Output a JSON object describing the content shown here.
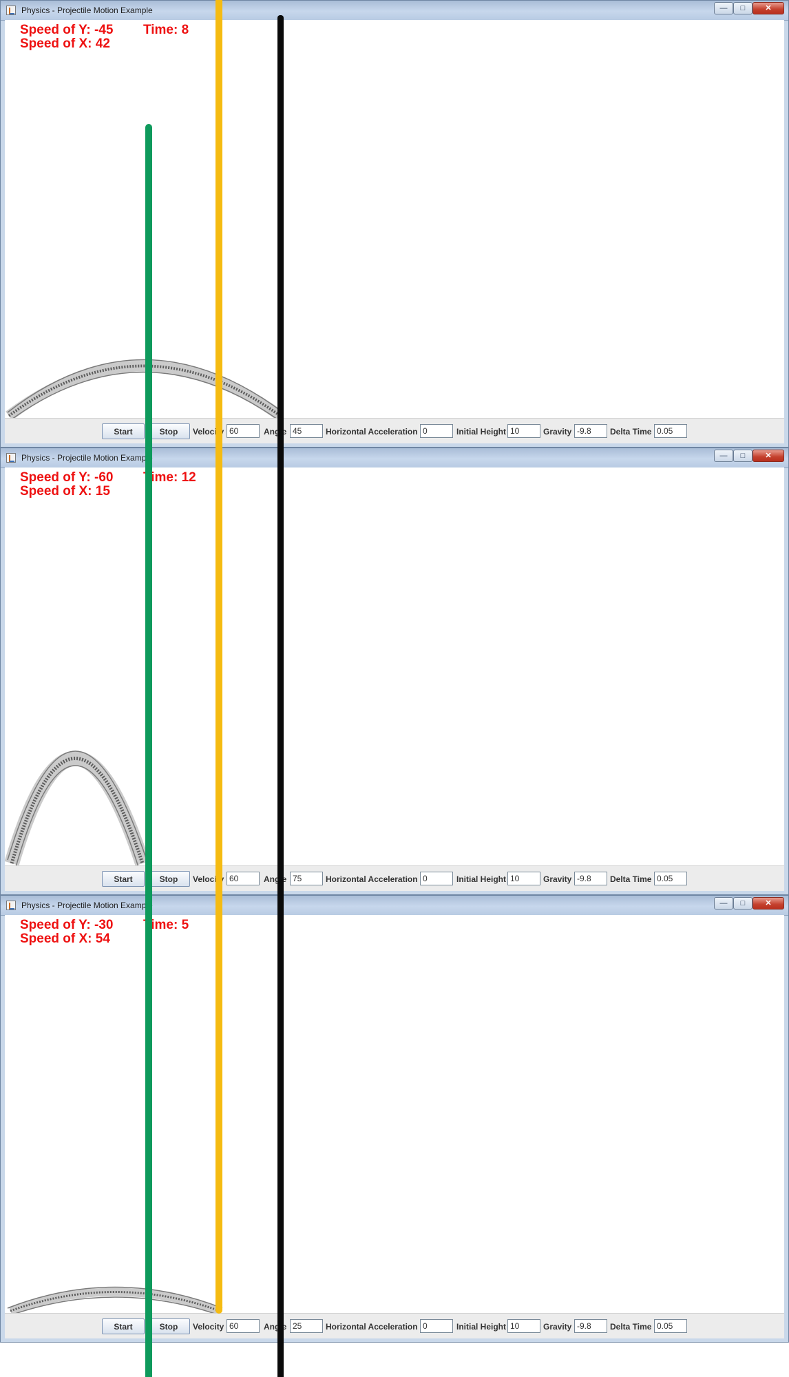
{
  "windows": [
    {
      "title": "Physics - Projectile Motion Example",
      "readout": {
        "speed_y": "Speed of Y: -45",
        "time": "Time: 8",
        "speed_x": "Speed of X: 42"
      },
      "buttons": {
        "start": "Start",
        "stop": "Stop"
      },
      "fields": {
        "velocity_label": "Velocity",
        "velocity": "60",
        "angle_label": "Angle",
        "angle": "45",
        "hacc_label": "Horizontal Acceleration",
        "hacc": "0",
        "height_label": "Initial Height",
        "height": "10",
        "gravity_label": "Gravity",
        "gravity": "-9.8",
        "dt_label": "Delta Time",
        "dt": "0.05"
      }
    },
    {
      "title": "Physics - Projectile Motion Example",
      "readout": {
        "speed_y": "Speed of Y: -60",
        "time": "Time: 12",
        "speed_x": "Speed of X: 15"
      },
      "buttons": {
        "start": "Start",
        "stop": "Stop"
      },
      "fields": {
        "velocity_label": "Velocity",
        "velocity": "60",
        "angle_label": "Angle",
        "angle": "75",
        "hacc_label": "Horizontal Acceleration",
        "hacc": "0",
        "height_label": "Initial Height",
        "height": "10",
        "gravity_label": "Gravity",
        "gravity": "-9.8",
        "dt_label": "Delta Time",
        "dt": "0.05"
      }
    },
    {
      "title": "Physics - Projectile Motion Example",
      "readout": {
        "speed_y": "Speed of Y: -30",
        "time": "Time: 5",
        "speed_x": "Speed of X: 54"
      },
      "buttons": {
        "start": "Start",
        "stop": "Stop"
      },
      "fields": {
        "velocity_label": "Velocity",
        "velocity": "60",
        "angle_label": "Angle",
        "angle": "25",
        "hacc_label": "Horizontal Acceleration",
        "hacc": "0",
        "height_label": "Initial Height",
        "height": "10",
        "gravity_label": "Gravity",
        "gravity": "-9.8",
        "dt_label": "Delta Time",
        "dt": "0.05"
      }
    }
  ],
  "colors": {
    "readout": "#ee1111",
    "trajectory": "#6a6a6a",
    "overlay_green": "#0e9a5c",
    "overlay_yellow": "#f5bb12",
    "overlay_black": "#0a0a0a"
  },
  "icons": [
    "java-app-icon",
    "minimize-icon",
    "maximize-icon",
    "close-icon"
  ]
}
